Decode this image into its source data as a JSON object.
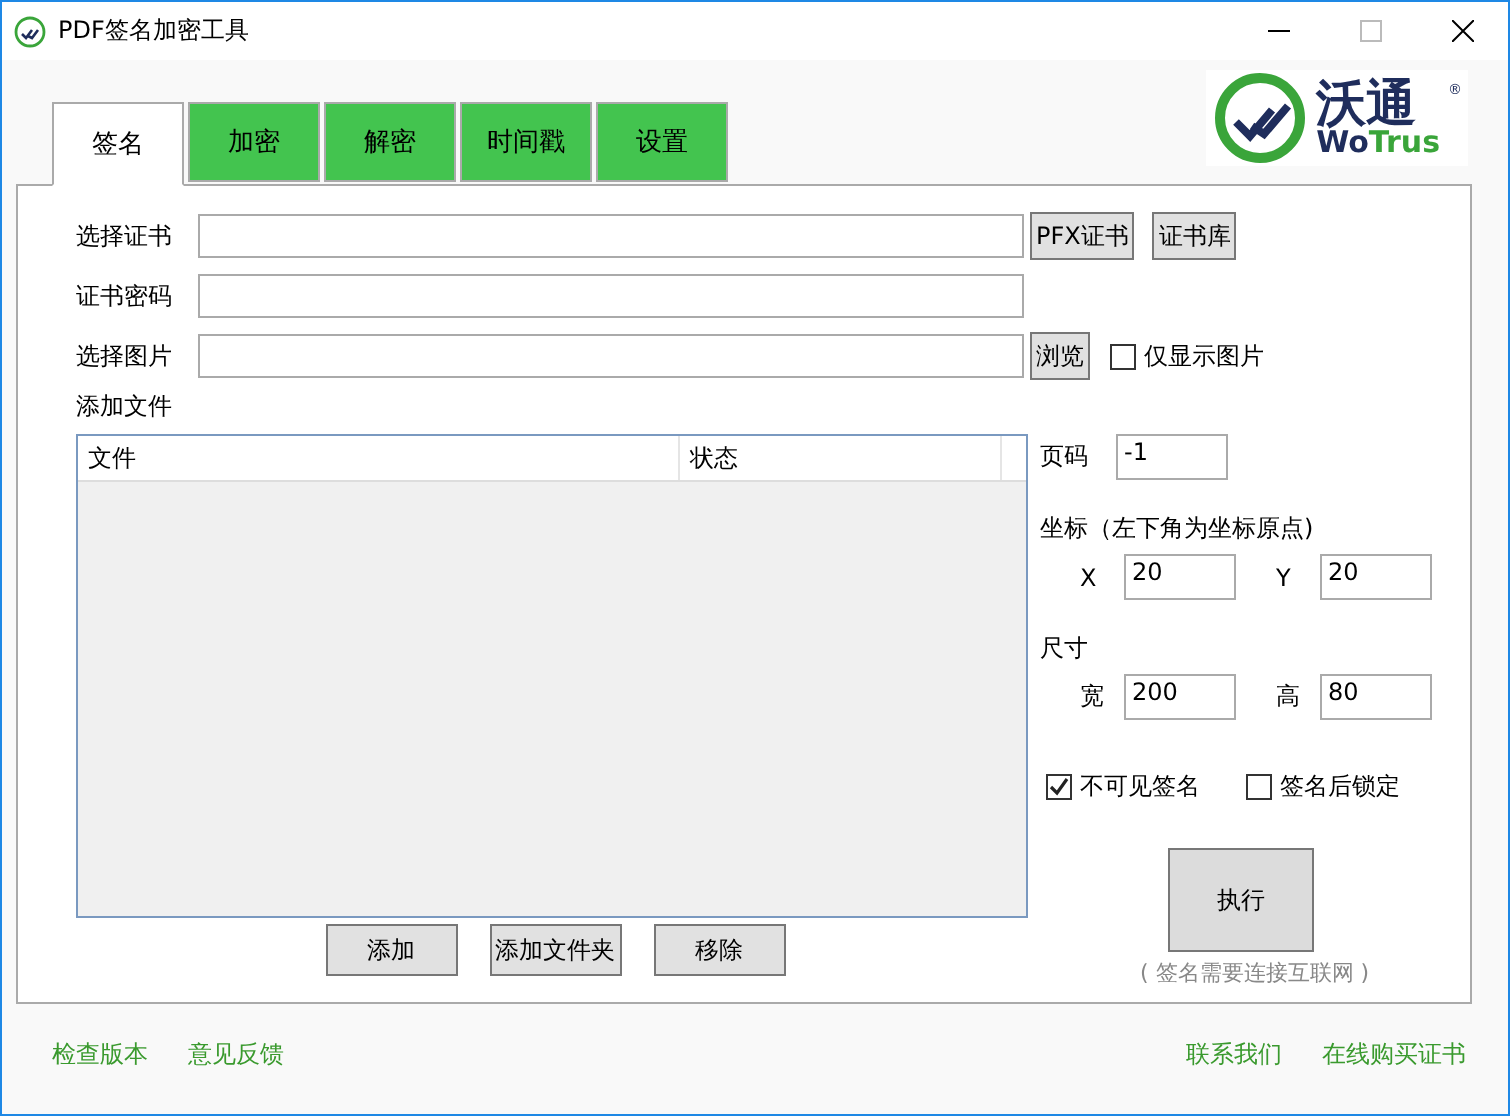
{
  "window": {
    "title": "PDF签名加密工具"
  },
  "logo": {
    "name": "沃通",
    "latin_1": "Wo",
    "latin_2": "Trus",
    "mark": "®"
  },
  "tabs": [
    {
      "label": "签名",
      "selected": true
    },
    {
      "label": "加密",
      "selected": false
    },
    {
      "label": "解密",
      "selected": false
    },
    {
      "label": "时间戳",
      "selected": false
    },
    {
      "label": "设置",
      "selected": false
    }
  ],
  "form": {
    "rows": [
      {
        "label": "选择证书",
        "value": "",
        "buttons": [
          "PFX证书",
          "证书库"
        ]
      },
      {
        "label": "证书密码",
        "value": "",
        "buttons": []
      },
      {
        "label": "选择图片",
        "value": "",
        "buttons": [
          "浏览"
        ],
        "checkbox": {
          "label": "仅显示图片",
          "checked": false
        }
      }
    ]
  },
  "files": {
    "label": "添加文件",
    "columns": [
      "文件",
      "状态"
    ],
    "buttons": [
      "添加",
      "添加文件夹",
      "移除"
    ]
  },
  "page": {
    "label": "页码",
    "value": "-1"
  },
  "coords": {
    "label": "坐标（左下角为坐标原点)",
    "fields": [
      {
        "label": "X",
        "value": "20"
      },
      {
        "label": "Y",
        "value": "20"
      }
    ]
  },
  "size": {
    "label": "尺寸",
    "fields": [
      {
        "label": "宽",
        "value": "200"
      },
      {
        "label": "高",
        "value": "80"
      }
    ]
  },
  "options": [
    {
      "label": "不可见签名",
      "checked": true
    },
    {
      "label": "签名后锁定",
      "checked": false
    }
  ],
  "run": {
    "label": "执行",
    "note": "( 签名需要连接互联网 )"
  },
  "footer": {
    "left": [
      "检查版本",
      "意见反馈"
    ],
    "right": [
      "联系我们",
      "在线购买证书"
    ]
  }
}
